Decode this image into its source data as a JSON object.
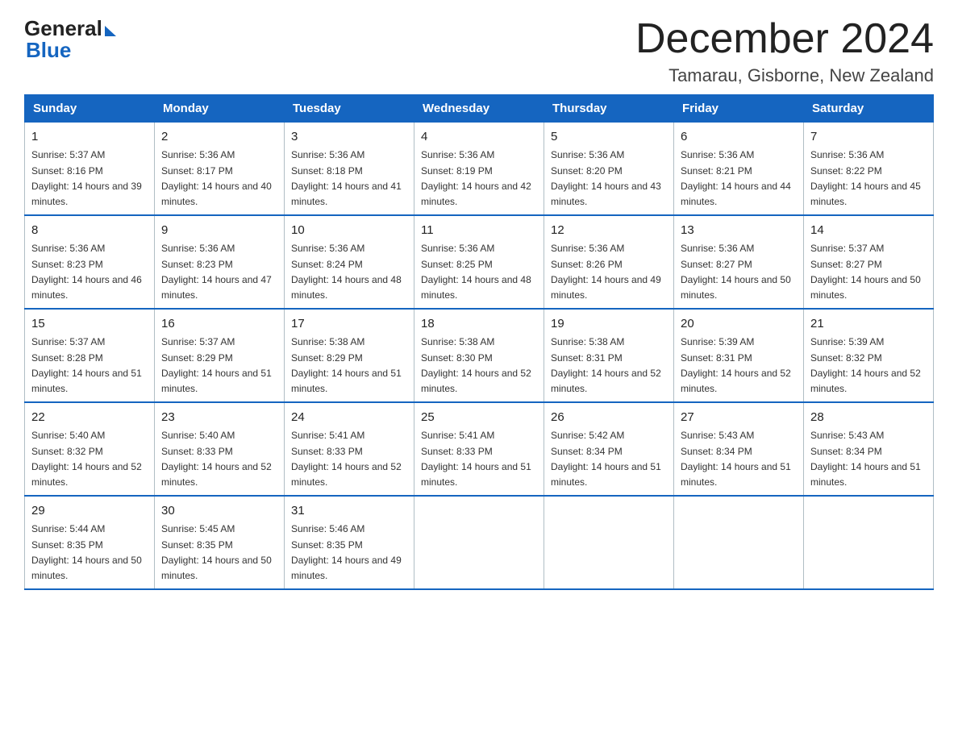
{
  "header": {
    "logo_general": "General",
    "logo_blue": "Blue",
    "month_title": "December 2024",
    "location": "Tamarau, Gisborne, New Zealand"
  },
  "days_of_week": [
    "Sunday",
    "Monday",
    "Tuesday",
    "Wednesday",
    "Thursday",
    "Friday",
    "Saturday"
  ],
  "weeks": [
    [
      {
        "num": "1",
        "sunrise": "5:37 AM",
        "sunset": "8:16 PM",
        "daylight": "14 hours and 39 minutes."
      },
      {
        "num": "2",
        "sunrise": "5:36 AM",
        "sunset": "8:17 PM",
        "daylight": "14 hours and 40 minutes."
      },
      {
        "num": "3",
        "sunrise": "5:36 AM",
        "sunset": "8:18 PM",
        "daylight": "14 hours and 41 minutes."
      },
      {
        "num": "4",
        "sunrise": "5:36 AM",
        "sunset": "8:19 PM",
        "daylight": "14 hours and 42 minutes."
      },
      {
        "num": "5",
        "sunrise": "5:36 AM",
        "sunset": "8:20 PM",
        "daylight": "14 hours and 43 minutes."
      },
      {
        "num": "6",
        "sunrise": "5:36 AM",
        "sunset": "8:21 PM",
        "daylight": "14 hours and 44 minutes."
      },
      {
        "num": "7",
        "sunrise": "5:36 AM",
        "sunset": "8:22 PM",
        "daylight": "14 hours and 45 minutes."
      }
    ],
    [
      {
        "num": "8",
        "sunrise": "5:36 AM",
        "sunset": "8:23 PM",
        "daylight": "14 hours and 46 minutes."
      },
      {
        "num": "9",
        "sunrise": "5:36 AM",
        "sunset": "8:23 PM",
        "daylight": "14 hours and 47 minutes."
      },
      {
        "num": "10",
        "sunrise": "5:36 AM",
        "sunset": "8:24 PM",
        "daylight": "14 hours and 48 minutes."
      },
      {
        "num": "11",
        "sunrise": "5:36 AM",
        "sunset": "8:25 PM",
        "daylight": "14 hours and 48 minutes."
      },
      {
        "num": "12",
        "sunrise": "5:36 AM",
        "sunset": "8:26 PM",
        "daylight": "14 hours and 49 minutes."
      },
      {
        "num": "13",
        "sunrise": "5:36 AM",
        "sunset": "8:27 PM",
        "daylight": "14 hours and 50 minutes."
      },
      {
        "num": "14",
        "sunrise": "5:37 AM",
        "sunset": "8:27 PM",
        "daylight": "14 hours and 50 minutes."
      }
    ],
    [
      {
        "num": "15",
        "sunrise": "5:37 AM",
        "sunset": "8:28 PM",
        "daylight": "14 hours and 51 minutes."
      },
      {
        "num": "16",
        "sunrise": "5:37 AM",
        "sunset": "8:29 PM",
        "daylight": "14 hours and 51 minutes."
      },
      {
        "num": "17",
        "sunrise": "5:38 AM",
        "sunset": "8:29 PM",
        "daylight": "14 hours and 51 minutes."
      },
      {
        "num": "18",
        "sunrise": "5:38 AM",
        "sunset": "8:30 PM",
        "daylight": "14 hours and 52 minutes."
      },
      {
        "num": "19",
        "sunrise": "5:38 AM",
        "sunset": "8:31 PM",
        "daylight": "14 hours and 52 minutes."
      },
      {
        "num": "20",
        "sunrise": "5:39 AM",
        "sunset": "8:31 PM",
        "daylight": "14 hours and 52 minutes."
      },
      {
        "num": "21",
        "sunrise": "5:39 AM",
        "sunset": "8:32 PM",
        "daylight": "14 hours and 52 minutes."
      }
    ],
    [
      {
        "num": "22",
        "sunrise": "5:40 AM",
        "sunset": "8:32 PM",
        "daylight": "14 hours and 52 minutes."
      },
      {
        "num": "23",
        "sunrise": "5:40 AM",
        "sunset": "8:33 PM",
        "daylight": "14 hours and 52 minutes."
      },
      {
        "num": "24",
        "sunrise": "5:41 AM",
        "sunset": "8:33 PM",
        "daylight": "14 hours and 52 minutes."
      },
      {
        "num": "25",
        "sunrise": "5:41 AM",
        "sunset": "8:33 PM",
        "daylight": "14 hours and 51 minutes."
      },
      {
        "num": "26",
        "sunrise": "5:42 AM",
        "sunset": "8:34 PM",
        "daylight": "14 hours and 51 minutes."
      },
      {
        "num": "27",
        "sunrise": "5:43 AM",
        "sunset": "8:34 PM",
        "daylight": "14 hours and 51 minutes."
      },
      {
        "num": "28",
        "sunrise": "5:43 AM",
        "sunset": "8:34 PM",
        "daylight": "14 hours and 51 minutes."
      }
    ],
    [
      {
        "num": "29",
        "sunrise": "5:44 AM",
        "sunset": "8:35 PM",
        "daylight": "14 hours and 50 minutes."
      },
      {
        "num": "30",
        "sunrise": "5:45 AM",
        "sunset": "8:35 PM",
        "daylight": "14 hours and 50 minutes."
      },
      {
        "num": "31",
        "sunrise": "5:46 AM",
        "sunset": "8:35 PM",
        "daylight": "14 hours and 49 minutes."
      },
      {
        "num": "",
        "sunrise": "",
        "sunset": "",
        "daylight": ""
      },
      {
        "num": "",
        "sunrise": "",
        "sunset": "",
        "daylight": ""
      },
      {
        "num": "",
        "sunrise": "",
        "sunset": "",
        "daylight": ""
      },
      {
        "num": "",
        "sunrise": "",
        "sunset": "",
        "daylight": ""
      }
    ]
  ]
}
